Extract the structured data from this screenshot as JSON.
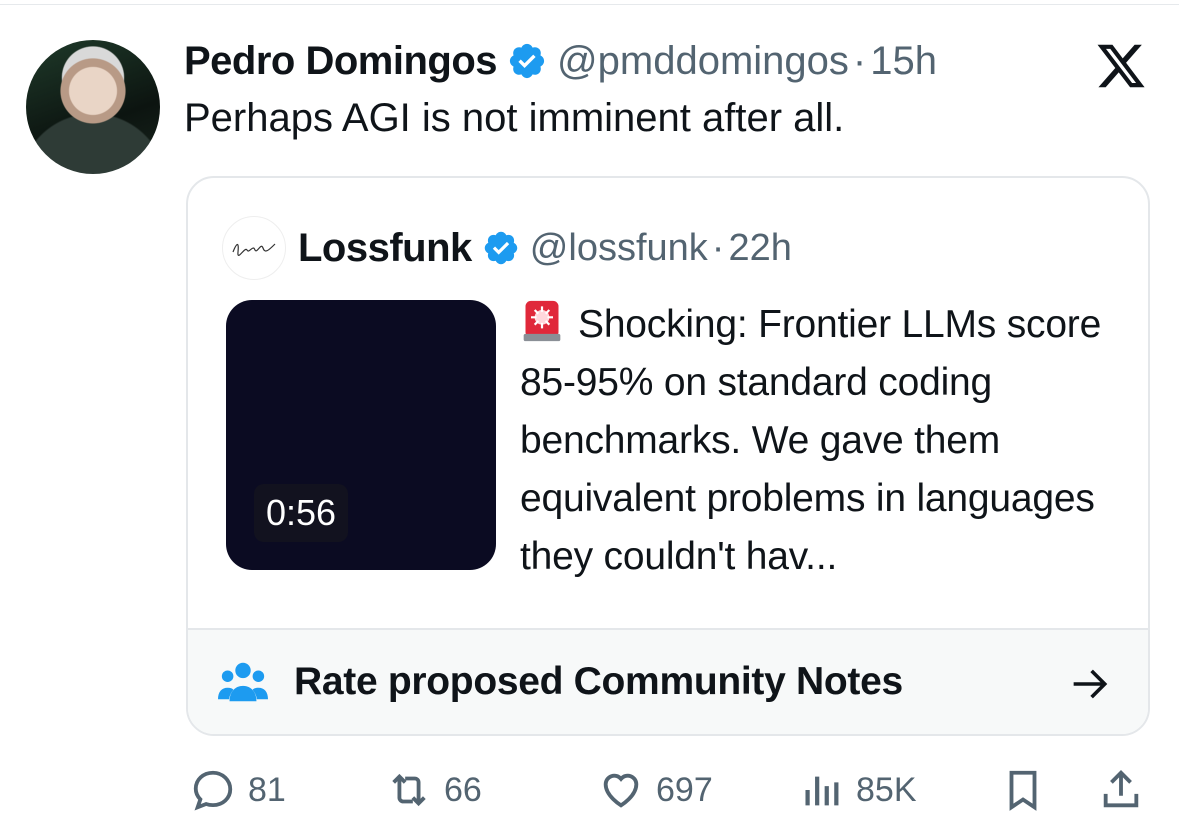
{
  "tweet": {
    "author_name": "Pedro Domingos",
    "author_handle": "@pmddomingos",
    "separator": "·",
    "time": "15h",
    "text": "Perhaps AGI is not imminent after all."
  },
  "quoted_tweet": {
    "author_name": "Lossfunk",
    "author_handle": "@lossfunk",
    "separator": "·",
    "time": "22h",
    "video_duration": "0:56",
    "text": "Shocking: Frontier LLMs score 85-95% on standard coding benchmarks. We gave them equivalent problems in languages they couldn't hav...",
    "emoji_icon": "rotating-light-icon"
  },
  "community_notes": {
    "label": "Rate proposed Community Notes"
  },
  "actions": {
    "replies": "81",
    "reposts": "66",
    "likes": "697",
    "views": "85K"
  },
  "colors": {
    "verified": "#1d9bf0",
    "secondary_text": "#536471",
    "notes_icon": "#1d9bf0"
  }
}
